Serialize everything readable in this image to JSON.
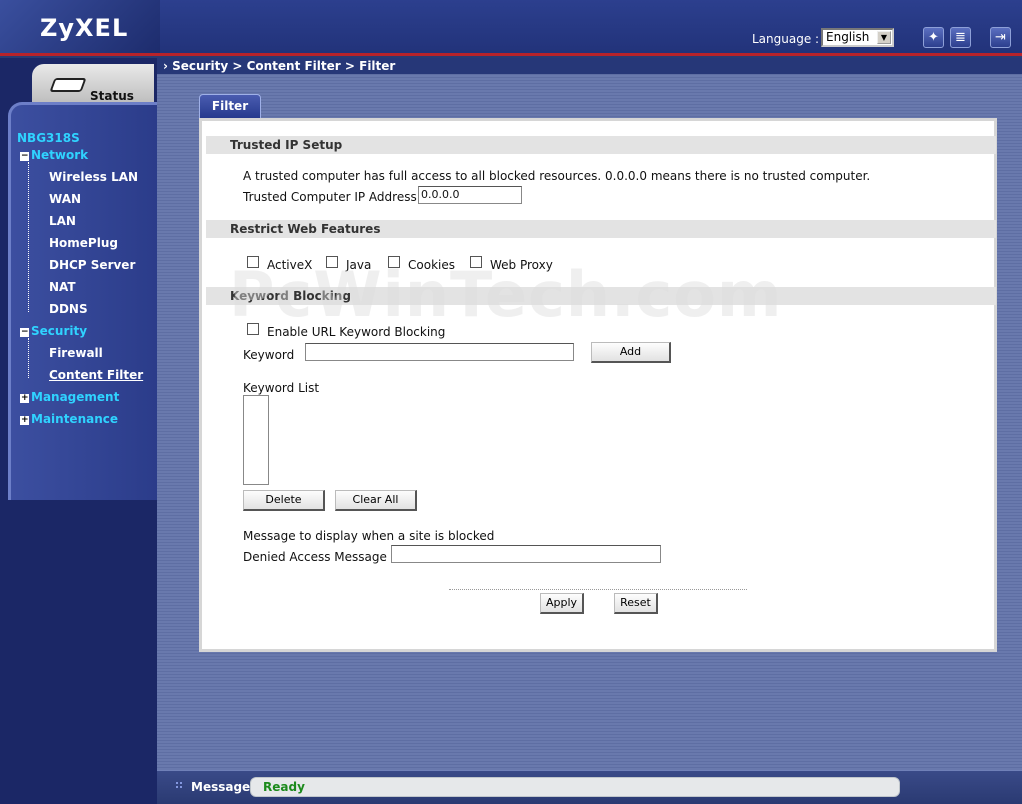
{
  "header": {
    "logo": "ZyXEL",
    "language_label": "Language :",
    "language_value": "English",
    "icons": [
      "wizard-icon",
      "logout-notes-icon",
      "exit-icon"
    ]
  },
  "breadcrumb": "Security > Content Filter > Filter",
  "sidebar": {
    "status_label": "Status",
    "device": "NBG318S",
    "network": {
      "label": "Network",
      "items": [
        "Wireless LAN",
        "WAN",
        "LAN",
        "HomePlug",
        "DHCP Server",
        "NAT",
        "DDNS"
      ]
    },
    "security": {
      "label": "Security",
      "items": [
        "Firewall",
        "Content Filter"
      ],
      "active": "Content Filter"
    },
    "management": "Management",
    "maintenance": "Maintenance"
  },
  "tab": "Filter",
  "trusted": {
    "title": "Trusted IP Setup",
    "desc": "A trusted computer has full access to all blocked resources. 0.0.0.0 means there is no trusted computer.",
    "ip_label": "Trusted Computer IP Address:",
    "ip_value": "0.0.0.0"
  },
  "restrict": {
    "title": "Restrict Web Features",
    "options": [
      "ActiveX",
      "Java",
      "Cookies",
      "Web Proxy"
    ]
  },
  "keyword": {
    "title": "Keyword Blocking",
    "enable_label": "Enable URL Keyword Blocking",
    "keyword_label": "Keyword",
    "keyword_value": "",
    "add": "Add",
    "list_label": "Keyword List",
    "delete": "Delete",
    "clear_all": "Clear All",
    "msg_desc": "Message to display when a site is blocked",
    "denied_label": "Denied Access Message",
    "denied_value": ""
  },
  "actions": {
    "apply": "Apply",
    "reset": "Reset"
  },
  "watermark": "PcWinTech.com",
  "statusbar": {
    "label": "Message",
    "value": "Ready"
  }
}
